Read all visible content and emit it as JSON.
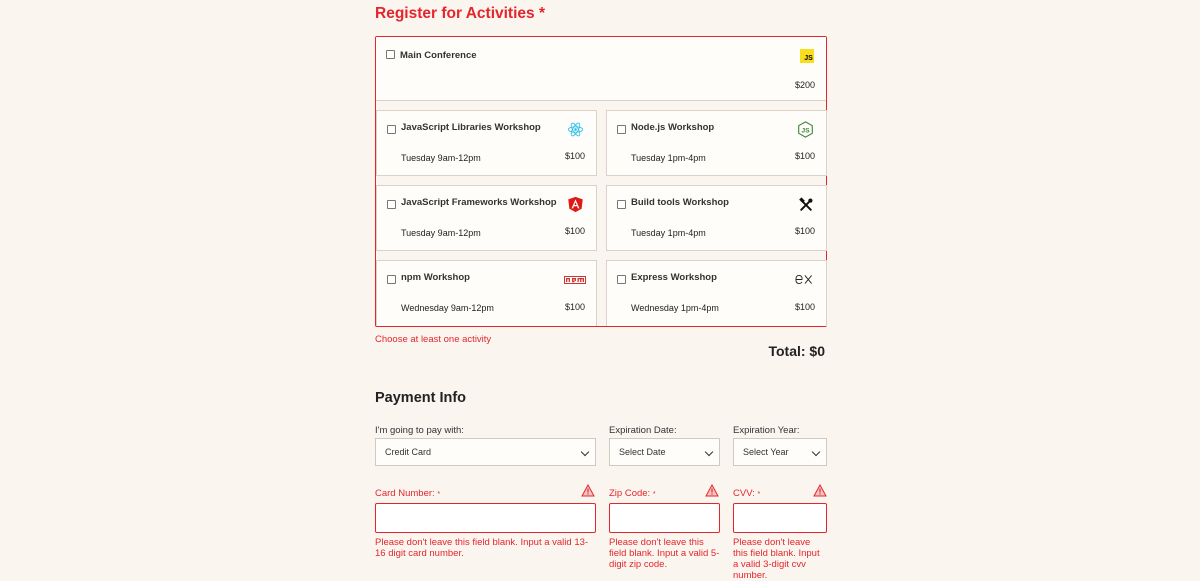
{
  "activities": {
    "heading": "Register for Activities",
    "required_mark": "*",
    "main": {
      "name": "Main Conference",
      "cost": "$200",
      "icon": "js-icon"
    },
    "workshops": [
      {
        "name": "JavaScript Libraries Workshop",
        "time": "Tuesday 9am-12pm",
        "cost": "$100",
        "icon": "react-icon"
      },
      {
        "name": "Node.js Workshop",
        "time": "Tuesday 1pm-4pm",
        "cost": "$100",
        "icon": "nodejs-icon"
      },
      {
        "name": "JavaScript Frameworks Workshop",
        "time": "Tuesday 9am-12pm",
        "cost": "$100",
        "icon": "angular-icon"
      },
      {
        "name": "Build tools Workshop",
        "time": "Tuesday 1pm-4pm",
        "cost": "$100",
        "icon": "tools-icon"
      },
      {
        "name": "npm Workshop",
        "time": "Wednesday 9am-12pm",
        "cost": "$100",
        "icon": "npm-icon"
      },
      {
        "name": "Express Workshop",
        "time": "Wednesday 1pm-4pm",
        "cost": "$100",
        "icon": "express-icon"
      }
    ],
    "error": "Choose at least one activity",
    "total": "Total: $0"
  },
  "payment": {
    "heading": "Payment Info",
    "method_label": "I'm going to pay with:",
    "method_value": "Credit Card",
    "exp_date_label": "Expiration Date:",
    "exp_date_value": "Select Date",
    "exp_year_label": "Expiration Year:",
    "exp_year_value": "Select Year",
    "card_number_label": "Card Number:",
    "zip_label": "Zip Code:",
    "cvv_label": "CVV:",
    "card_number_error": "Please don't leave this field blank. Input a valid 13-16 digit card number.",
    "zip_error": "Please don't leave this field blank. Input a valid 5-digit zip code.",
    "cvv_error": "Please don't leave this field blank. Input a valid 3-digit cvv number."
  },
  "colors": {
    "error": "#e4262c",
    "background": "#faf5ef",
    "js_yellow": "#f7df1e",
    "node_green": "#3c873a",
    "angular_red": "#dd1b16",
    "npm_red": "#cb3837"
  }
}
